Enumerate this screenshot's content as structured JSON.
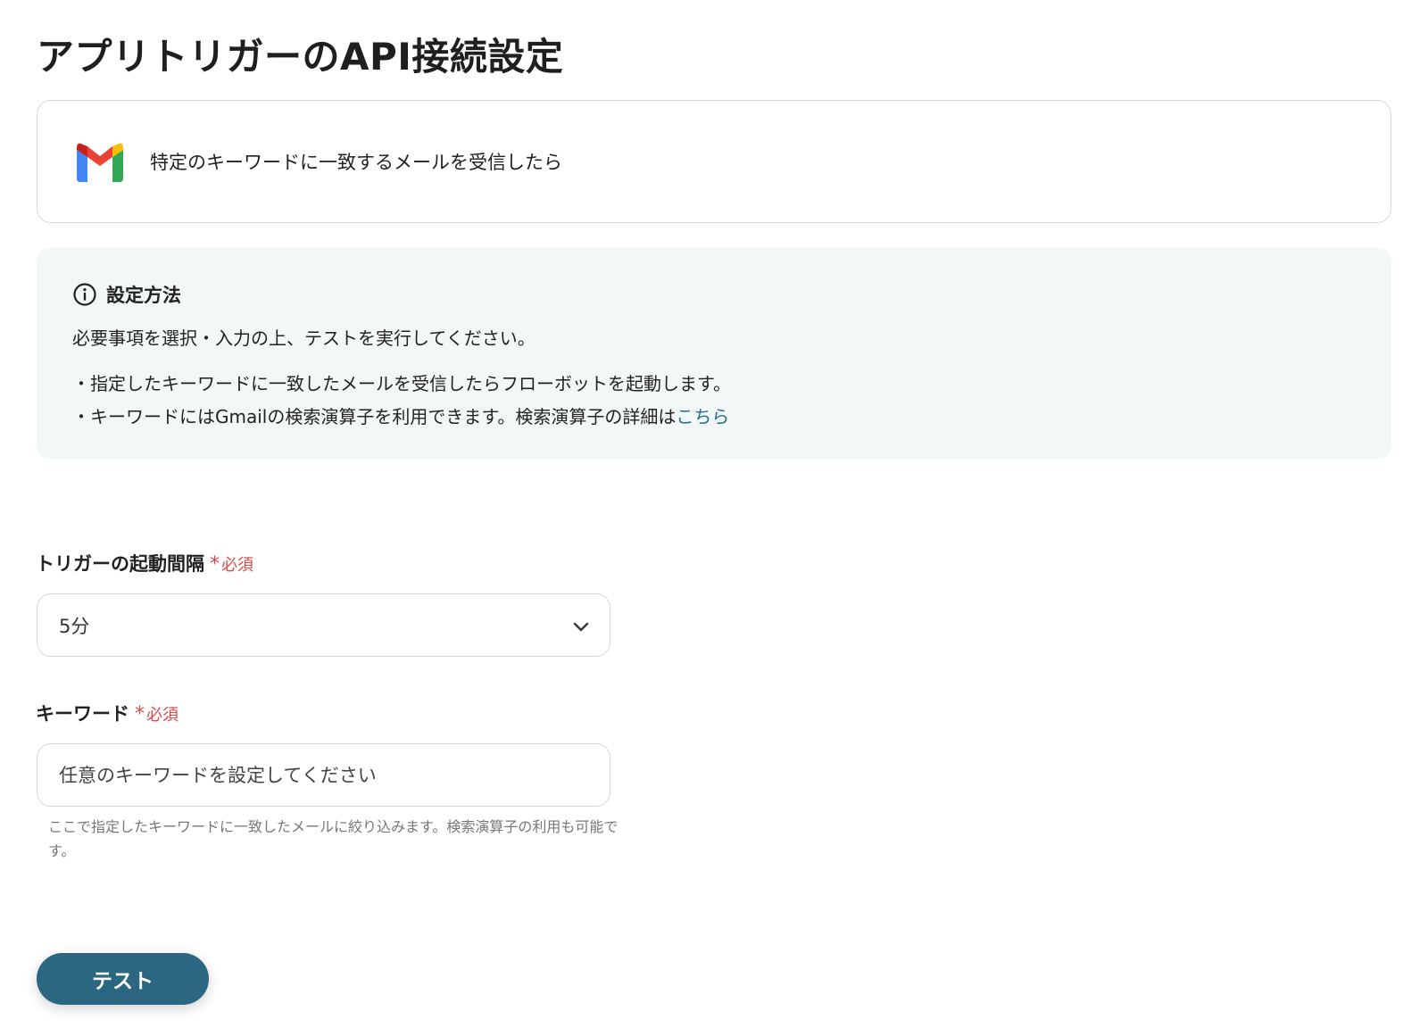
{
  "page": {
    "title": "アプリトリガーのAPI接続設定"
  },
  "trigger": {
    "app_icon": "gmail-icon",
    "label": "特定のキーワードに一致するメールを受信したら"
  },
  "info": {
    "icon": "info-icon",
    "heading": "設定方法",
    "line1": "必要事項を選択・入力の上、テストを実行してください。",
    "line2": "・指定したキーワードに一致したメールを受信したらフローボットを起動します。",
    "line3_prefix": "・キーワードにはGmailの検索演算子を利用できます。検索演算子の詳細は",
    "line3_link": "こちら"
  },
  "interval": {
    "label": "トリガーの起動間隔",
    "required_mark": "*",
    "required_text": "必須",
    "selected_value": "5分"
  },
  "keyword": {
    "label": "キーワード",
    "required_mark": "*",
    "required_text": "必須",
    "placeholder": "任意のキーワードを設定してください",
    "value": "",
    "help": "ここで指定したキーワードに一致したメールに絞り込みます。検索演算子の利用も可能です。"
  },
  "actions": {
    "test_label": "テスト"
  },
  "colors": {
    "accent": "#2b6781",
    "link": "#2a6f8a",
    "required": "#e04848",
    "info_bg": "#f2f7f7"
  }
}
